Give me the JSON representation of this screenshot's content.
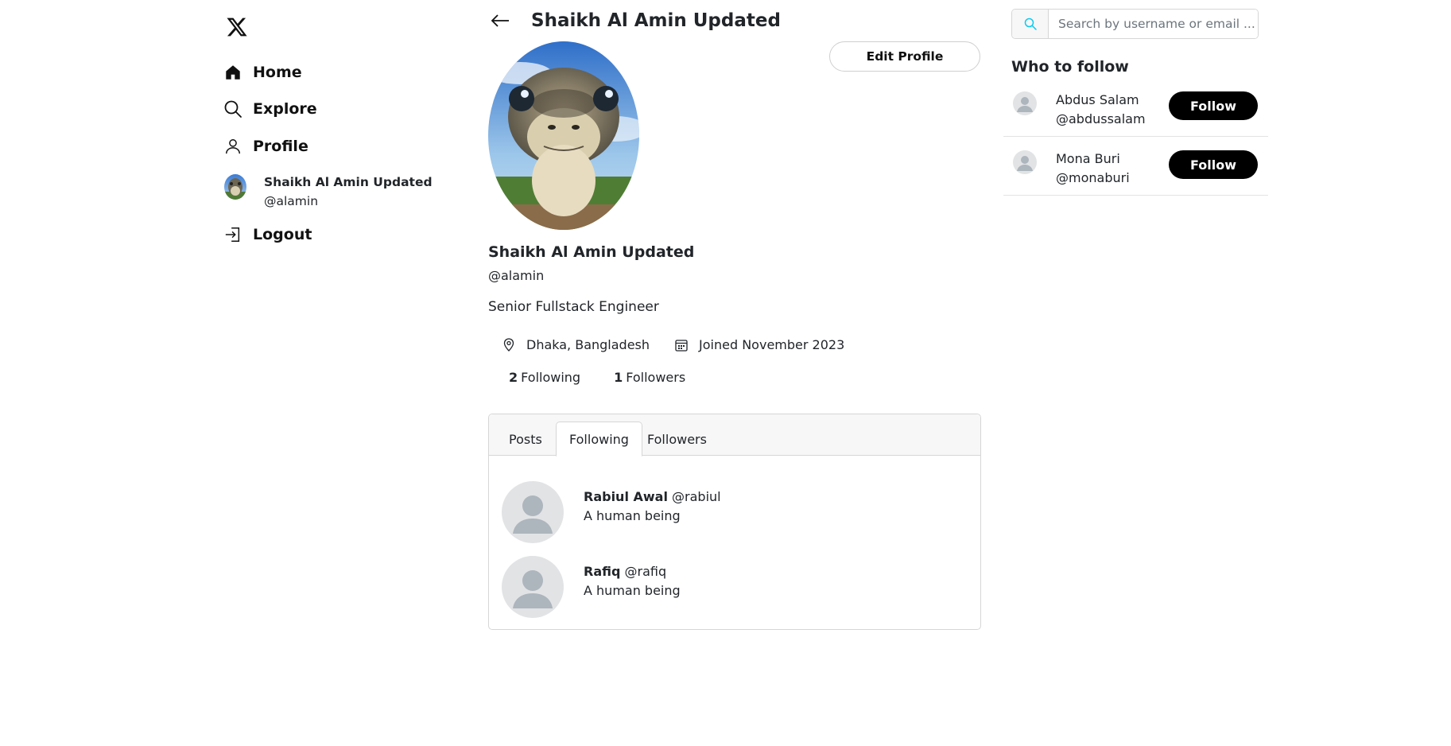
{
  "sidebar": {
    "logo_icon": "x-logo-icon",
    "nav": {
      "home": "Home",
      "explore": "Explore",
      "profile": "Profile",
      "logout": "Logout"
    },
    "current_user": {
      "name": "Shaikh Al Amin Updated",
      "handle": "@alamin"
    }
  },
  "header": {
    "title": "Shaikh Al Amin Updated"
  },
  "profile": {
    "edit_button": "Edit Profile",
    "name": "Shaikh Al Amin Updated",
    "handle": "@alamin",
    "bio": "Senior Fullstack Engineer",
    "location": "Dhaka, Bangladesh",
    "joined": "Joined November 2023",
    "following_count": "2",
    "following_label": "Following",
    "followers_count": "1",
    "followers_label": "Followers"
  },
  "tabs": {
    "posts": "Posts",
    "following": "Following",
    "followers": "Followers",
    "active": "Following"
  },
  "following_list": [
    {
      "name": "Rabiul Awal",
      "handle": "@rabiul",
      "bio": "A human being"
    },
    {
      "name": "Rafiq",
      "handle": "@rafiq",
      "bio": "A human being"
    }
  ],
  "search": {
    "placeholder": "Search by username or email ..."
  },
  "who_to_follow": {
    "title": "Who to follow",
    "items": [
      {
        "name": "Abdus Salam",
        "handle": "@abdussalam",
        "button": "Follow"
      },
      {
        "name": "Mona Buri",
        "handle": "@monaburi",
        "button": "Follow"
      }
    ]
  },
  "colors": {
    "accent": "#000000",
    "search_icon": "#0dcaf0",
    "avatar_placeholder": "#e2e3e5"
  }
}
